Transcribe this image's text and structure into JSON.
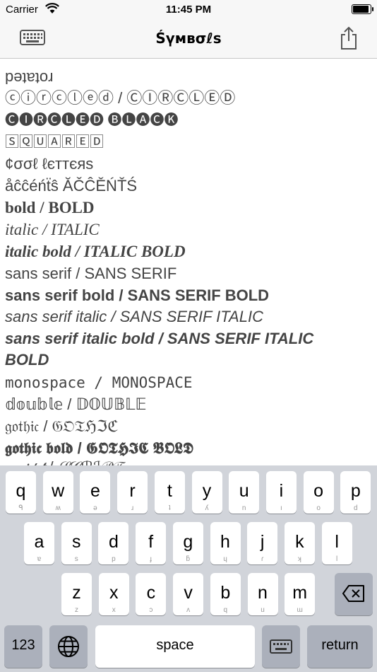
{
  "status_bar": {
    "carrier": "Carrier",
    "time": "11:45 PM",
    "battery_level": 1.0,
    "wifi_icon": "wifi-icon",
    "battery_icon": "battery-icon"
  },
  "nav": {
    "title": "Śүмвσℓѕ",
    "left_icon": "keyboard-icon",
    "right_icon": "share-icon"
  },
  "rows": {
    "rotated": "rotated",
    "circled": "ⓒⓘⓡⓒⓛⓔⓓ / ⒸⒾⓇⒸⓁⒺⒹ",
    "circled_black": "🅒🅘🅡🅒🅛🅔🅓 🅑🅛🅐🅒🅚",
    "squared": "🅂🅀🅄🄰🅁🄴🄳",
    "cool": "¢σσℓ ℓєттєяѕ",
    "accents": "åĉĉéńẗŝ ĂČĈĚŃŤŚ",
    "bold": "bold / BOLD",
    "italic": "italic / ITALIC",
    "italic_bold": "italic bold / ITALIC BOLD",
    "sans_serif": "sans serif / SANS SERIF",
    "sans_serif_bold": "sans serif bold / SANS SERIF BOLD",
    "sans_serif_italic": "sans serif italic / SANS SERIF ITALIC",
    "sans_serif_italic_bold_1": "sans serif italic bold / SANS SERIF ITALIC",
    "sans_serif_italic_bold_2": "BOLD",
    "monospace": "monospace / MONOSPACE",
    "double": "𝕕𝕠𝕦𝕓𝕝𝕖 / 𝔻𝕆𝕌𝔹𝕃𝔼",
    "gothic": "𝔤𝔬𝔱𝔥𝔦𝔠 / 𝔊𝔒𝔗ℌℑℭ",
    "gothic_bold": "𝖌𝖔𝖙𝖍𝖎𝖈 𝖇𝖔𝖑𝖉 / 𝕲𝕺𝕿𝕳𝕴𝕮 𝕭𝕺𝕷𝕯",
    "script_partial": "𝓈𝒸𝓇𝒾𝓅𝓉 / 𝒮𝒞ℛℐ𝒫𝒯"
  },
  "keyboard": {
    "row1": [
      {
        "label": "q",
        "sub": "ᑫ"
      },
      {
        "label": "w",
        "sub": "ʍ"
      },
      {
        "label": "e",
        "sub": "ǝ"
      },
      {
        "label": "r",
        "sub": "ɹ"
      },
      {
        "label": "t",
        "sub": "ʇ"
      },
      {
        "label": "y",
        "sub": "ʎ"
      },
      {
        "label": "u",
        "sub": "n"
      },
      {
        "label": "i",
        "sub": "ı"
      },
      {
        "label": "o",
        "sub": "o"
      },
      {
        "label": "p",
        "sub": "d"
      }
    ],
    "row2": [
      {
        "label": "a",
        "sub": "ɐ"
      },
      {
        "label": "s",
        "sub": "s"
      },
      {
        "label": "d",
        "sub": "p"
      },
      {
        "label": "f",
        "sub": "ɟ"
      },
      {
        "label": "g",
        "sub": "ƃ"
      },
      {
        "label": "h",
        "sub": "ɥ"
      },
      {
        "label": "j",
        "sub": "ɾ"
      },
      {
        "label": "k",
        "sub": "ʞ"
      },
      {
        "label": "l",
        "sub": "l"
      }
    ],
    "row3": [
      {
        "label": "z",
        "sub": "z"
      },
      {
        "label": "x",
        "sub": "x"
      },
      {
        "label": "c",
        "sub": "ɔ"
      },
      {
        "label": "v",
        "sub": "ʌ"
      },
      {
        "label": "b",
        "sub": "q"
      },
      {
        "label": "n",
        "sub": "u"
      },
      {
        "label": "m",
        "sub": "ɯ"
      }
    ],
    "numbers_label": "123",
    "space_label": "space",
    "return_label": "return",
    "globe_icon": "globe-icon",
    "dismiss_icon": "keyboard-dismiss-icon",
    "delete_icon": "delete-icon"
  }
}
